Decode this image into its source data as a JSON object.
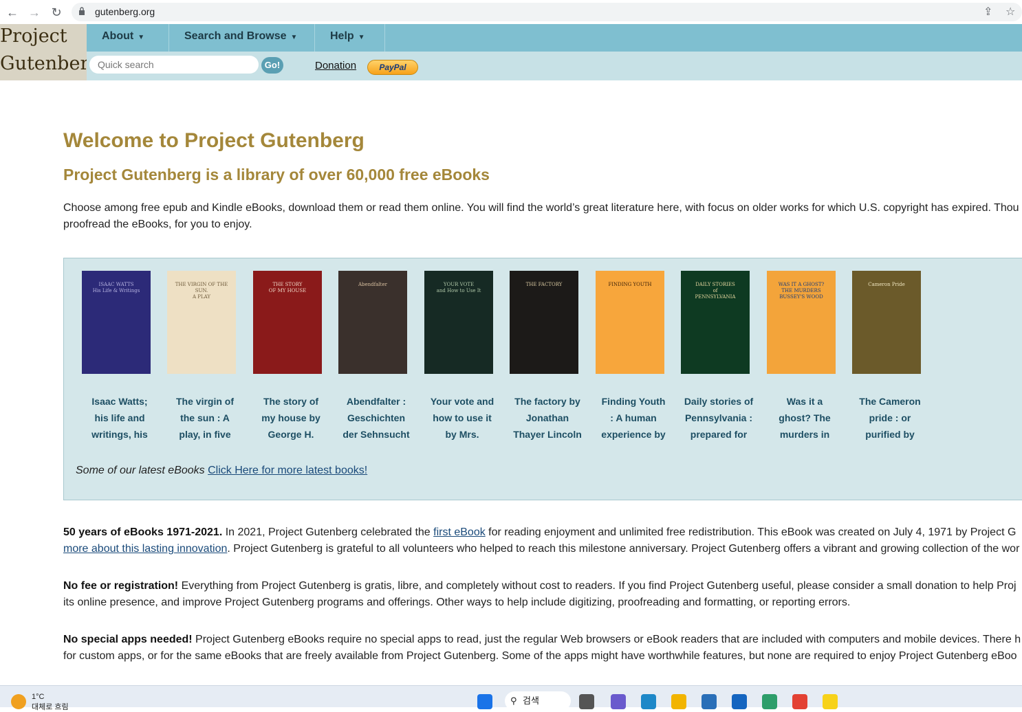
{
  "browser": {
    "url": "gutenberg.org",
    "back": "←",
    "forward": "→",
    "reload": "↻",
    "share": "⇪",
    "star": "☆"
  },
  "header": {
    "logo_line1": "Project",
    "logo_line2": "Gutenberg",
    "menu": [
      {
        "label": "About"
      },
      {
        "label": "Search and Browse"
      },
      {
        "label": "Help"
      }
    ],
    "search_placeholder": "Quick search",
    "go_label": "Go!",
    "donation_label": "Donation",
    "paypal_label": "PayPal"
  },
  "main": {
    "welcome": "Welcome to Project Gutenberg",
    "subtitle": "Project Gutenberg is a library of over 60,000 free eBooks",
    "intro_line1": "Choose among free epub and Kindle eBooks, download them or read them online. You will find the world’s great literature here, with focus on older works for which U.S. copyright has expired. Thou",
    "intro_line2": "proofread the eBooks, for you to enjoy.",
    "books": [
      {
        "l1": "Isaac Watts;",
        "l2": "his life and",
        "l3": "writings, his",
        "cover_text": "ISAAC WATTS\nHis Life & Writings",
        "bg": "#2c2a78",
        "fg": "#b6b3e0"
      },
      {
        "l1": "The virgin of",
        "l2": "the sun :  A",
        "l3": "play, in five",
        "cover_text": "THE VIRGIN OF THE SUN.\nA PLAY",
        "bg": "#eee0c4",
        "fg": "#6e5a3a"
      },
      {
        "l1": "The story of",
        "l2": "my house by",
        "l3": "George H.",
        "cover_text": "THE STORY\nOF MY HOUSE",
        "bg": "#8a1a1a",
        "fg": "#f0d8c8"
      },
      {
        "l1": "Abendfalter :",
        "l2": "Geschichten",
        "l3": "der Sehnsucht",
        "cover_text": "Abendfalter",
        "bg": "#3a302c",
        "fg": "#d8c0a0"
      },
      {
        "l1": "Your vote and",
        "l2": "how to use it",
        "l3": "by Mrs.",
        "cover_text": "YOUR VOTE\nand How to Use It",
        "bg": "#162a24",
        "fg": "#b0c8a8"
      },
      {
        "l1": "The factory by",
        "l2": "Jonathan",
        "l3": "Thayer Lincoln",
        "cover_text": "THE FACTORY",
        "bg": "#1c1a18",
        "fg": "#d8c8a0"
      },
      {
        "l1": "Finding Youth",
        "l2": " :  A human",
        "l3": "experience by",
        "cover_text": "FINDING YOUTH",
        "bg": "#f7a63c",
        "fg": "#3a1f08"
      },
      {
        "l1": "Daily stories of",
        "l2": "Pennsylvania :",
        "l3": "prepared for",
        "cover_text": "DAILY STORIES\nof\nPENNSYLVANIA",
        "bg": "#0e3a22",
        "fg": "#e8d8a0"
      },
      {
        "l1": "Was it a",
        "l2": "ghost? The",
        "l3": "murders in",
        "cover_text": "WAS IT A GHOST?\nTHE MURDERS\nBUSSEY'S WOOD",
        "bg": "#f3a43a",
        "fg": "#1c3c7a"
      },
      {
        "l1": "The Cameron",
        "l2": "pride :  or",
        "l3": "purified by",
        "cover_text": "Cameron Pride",
        "bg": "#6b5a2a",
        "fg": "#f0e6c0"
      }
    ],
    "latest_text": "Some of our latest eBooks ",
    "latest_link": "Click Here for more latest books!",
    "p1_bold": "50 years of eBooks 1971-2021.",
    "p1_a": " In 2021, Project Gutenberg celebrated the ",
    "p1_link1": "first eBook",
    "p1_b": " for reading enjoyment and unlimited free redistribution. This eBook was created on July 4, 1971 by Project G",
    "p1_link2": "more about this lasting innovation",
    "p1_c": ". Project Gutenberg is grateful to all volunteers who helped to reach this milestone anniversary. Project Gutenberg offers a vibrant and growing collection of the wor",
    "p2_bold": "No fee or registration!",
    "p2_a": " Everything from Project Gutenberg is gratis, libre, and completely without cost to readers. If you find Project Gutenberg useful, please consider a small donation to help Proj",
    "p2_b": "its online presence, and improve Project Gutenberg programs and offerings. Other ways to help include digitizing, proofreading and formatting, or reporting errors.",
    "p3_bold": "No special apps needed!",
    "p3_a": " Project Gutenberg eBooks require no special apps to read, just the regular Web browsers or eBook readers that are included with computers and mobile devices. There h",
    "p3_b": "for custom apps, or for the same eBooks that are freely available from Project Gutenberg. Some of the apps might have worthwhile features, but none are required to enjoy Project Gutenberg eBoo"
  },
  "taskbar": {
    "temp": "1°C",
    "status": "대체로 흐림",
    "search_label": "검색",
    "search_icon": "⚲",
    "icons": [
      "start-icon",
      "task-view-icon",
      "chat-icon",
      "edge-icon",
      "file-explorer-icon",
      "store-icon",
      "mail-icon",
      "app-icon",
      "chrome-icon",
      "sticky-notes-icon"
    ]
  }
}
